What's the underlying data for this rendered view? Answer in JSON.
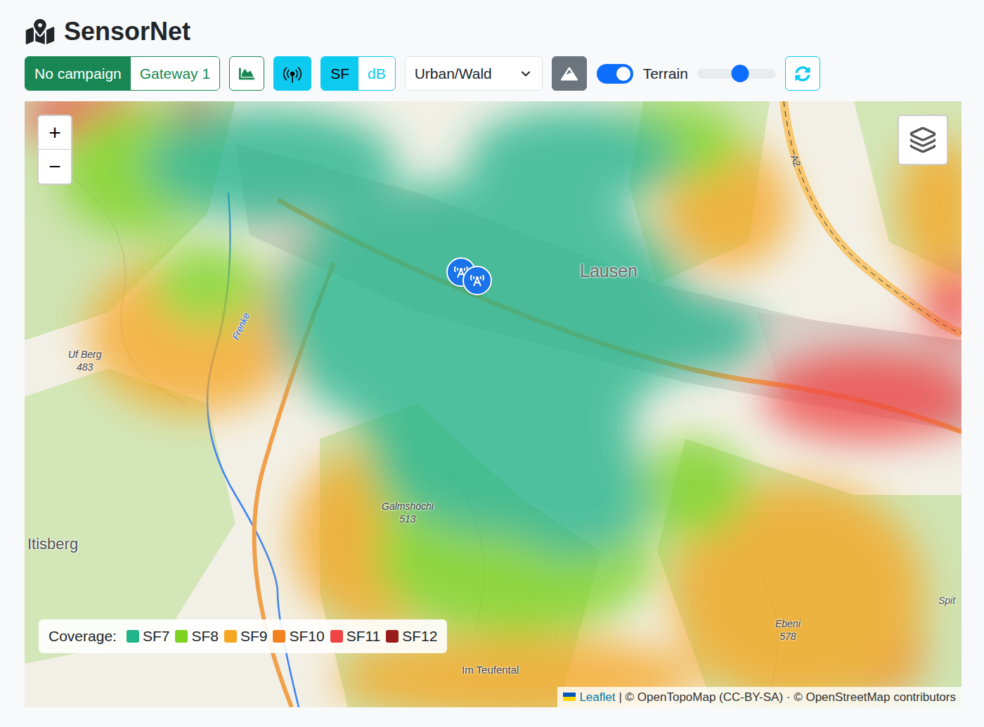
{
  "app": {
    "title": "SensorNet"
  },
  "toolbar": {
    "campaign_toggle": [
      {
        "label": "No campaign",
        "selected": true
      },
      {
        "label": "Gateway 1",
        "selected": false
      }
    ],
    "chart_button": {
      "selected": false
    },
    "gateway_button": {
      "selected": true
    },
    "mode_toggle": [
      {
        "label": "SF",
        "selected": true
      },
      {
        "label": "dB",
        "selected": false
      }
    ],
    "environment_select": {
      "value": "Urban/Wald"
    },
    "terrain_button": {
      "selected": true
    },
    "terrain_switch": {
      "label": "Terrain",
      "on": true
    },
    "opacity_slider": {
      "level": 0.55
    }
  },
  "map": {
    "zoom_in": "+",
    "zoom_out": "−",
    "labels": [
      {
        "name": "Lausen",
        "kind": "place"
      },
      {
        "name": "Uf Berg",
        "elevation": "483",
        "kind": "peak"
      },
      {
        "name": "Galmshöchi",
        "elevation": "513",
        "kind": "peak"
      },
      {
        "name": "Itisberg",
        "kind": "place"
      },
      {
        "name": "Ebeni",
        "elevation": "578",
        "kind": "peak"
      },
      {
        "name": "Spit",
        "kind": "small"
      },
      {
        "name": "Im Teufental",
        "kind": "small"
      },
      {
        "name": "Frenke",
        "kind": "river"
      },
      {
        "name": "A2",
        "kind": "road"
      }
    ],
    "markers": [
      {
        "kind": "gateway"
      },
      {
        "kind": "gateway"
      }
    ],
    "legend": {
      "title": "Coverage:",
      "items": [
        {
          "label": "SF7",
          "color": "#21b38a"
        },
        {
          "label": "SF8",
          "color": "#7ed321"
        },
        {
          "label": "SF9",
          "color": "#f5a623"
        },
        {
          "label": "SF10",
          "color": "#f58220"
        },
        {
          "label": "SF11",
          "color": "#ef4444"
        },
        {
          "label": "SF12",
          "color": "#9b1c1c"
        }
      ]
    },
    "attribution": {
      "link": "Leaflet",
      "text": "| © OpenTopoMap (CC-BY-SA) · © OpenStreetMap contributors"
    }
  }
}
